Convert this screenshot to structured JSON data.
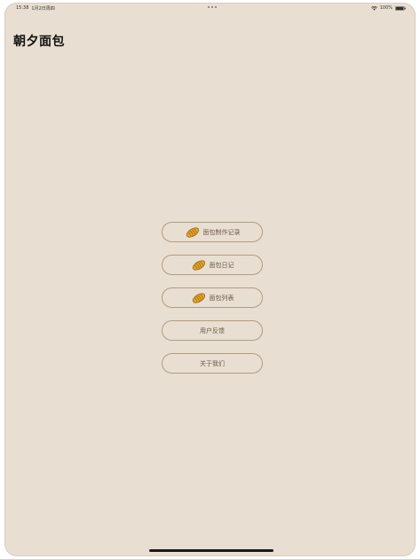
{
  "status_bar": {
    "time": "15:38",
    "date": "1月2日周四",
    "battery": "100%"
  },
  "header": {
    "title": "朝夕面包"
  },
  "menu": {
    "items": [
      {
        "label": "面包制作记录",
        "icon": "bread-icon"
      },
      {
        "label": "面包日记",
        "icon": "bread-icon"
      },
      {
        "label": "面包列表",
        "icon": "bread-icon"
      },
      {
        "label": "用户反馈"
      },
      {
        "label": "关于我们"
      }
    ]
  },
  "colors": {
    "background": "#e8dfd2",
    "button_border": "#b59a7e",
    "button_text": "#6e5a48",
    "bread": "#e6a62b"
  }
}
